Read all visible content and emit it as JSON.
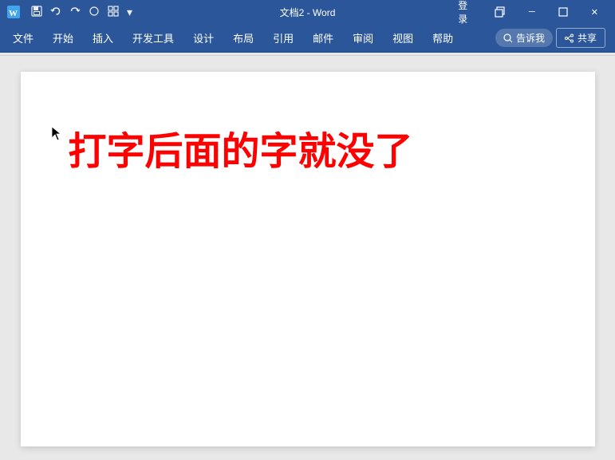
{
  "titlebar": {
    "title": "文档2 - Word",
    "login_label": "登录",
    "minimize_label": "─",
    "restore_label": "❐",
    "close_label": "✕"
  },
  "ribbon": {
    "tabs": [
      {
        "label": "文件",
        "active": false
      },
      {
        "label": "开始",
        "active": false
      },
      {
        "label": "插入",
        "active": false
      },
      {
        "label": "开发工具",
        "active": false
      },
      {
        "label": "设计",
        "active": false
      },
      {
        "label": "布局",
        "active": false
      },
      {
        "label": "引用",
        "active": false
      },
      {
        "label": "邮件",
        "active": false
      },
      {
        "label": "审阅",
        "active": false
      },
      {
        "label": "视图",
        "active": false
      },
      {
        "label": "帮助",
        "active": false
      }
    ],
    "search_placeholder": "告诉我",
    "share_label": "共享"
  },
  "document": {
    "main_text": "打字后面的字就没了"
  },
  "colors": {
    "ribbon_bg": "#2b579a",
    "text_red": "#ff0000",
    "page_bg": "#ffffff"
  }
}
